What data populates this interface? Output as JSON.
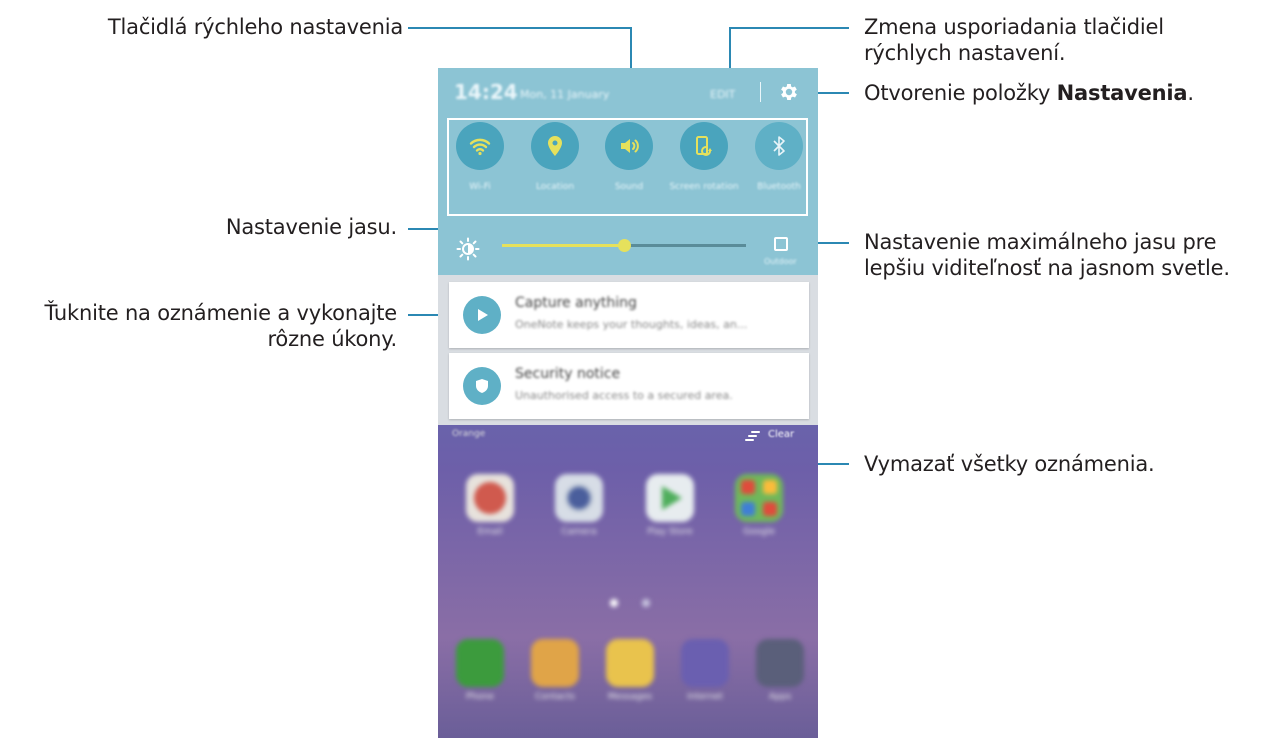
{
  "callouts": {
    "quick_buttons": "Tlačidlá rýchleho nastavenia",
    "rearrange_line1": "Zmena usporiadania tlačidiel",
    "rearrange_line2": "rýchlych nastavení.",
    "open_settings_prefix": "Otvorenie položky ",
    "open_settings_bold": "Nastavenia",
    "open_settings_suffix": ".",
    "brightness": "Nastavenie jasu.",
    "max_brightness_line1": "Nastavenie maximálneho jasu pre",
    "max_brightness_line2": "lepšiu viditeľnosť na jasnom svetle.",
    "notification_line1": "Ťuknite na oznámenie a vykonajte",
    "notification_line2": "rôzne úkony.",
    "clear_all": "Vymazať všetky oznámenia."
  },
  "phone": {
    "status": {
      "time": "14:24",
      "date": "Mon, 11 January",
      "edit": "EDIT"
    },
    "quick_settings": [
      {
        "label": "Wi-Fi",
        "icon": "wifi-icon"
      },
      {
        "label": "Location",
        "icon": "location-icon"
      },
      {
        "label": "Sound",
        "icon": "sound-icon"
      },
      {
        "label": "Screen rotation",
        "icon": "screen-rotation-icon"
      },
      {
        "label": "Bluetooth",
        "icon": "bluetooth-icon"
      }
    ],
    "brightness": {
      "level": 0.5,
      "outdoor_label": "Outdoor"
    },
    "notifications": [
      {
        "title": "Capture anything",
        "text": "OneNote keeps your thoughts, ideas, an..."
      },
      {
        "title": "Security notice",
        "text": "Unauthorised access to a secured area."
      }
    ],
    "clear": {
      "carrier": "Orange",
      "label": "Clear"
    },
    "apps": [
      {
        "label": "Email",
        "color": "#d05a4e"
      },
      {
        "label": "Camera",
        "color": "#b8c2d2"
      },
      {
        "label": "Play Store",
        "color": "#e7ecef"
      },
      {
        "label": "Google",
        "color": "#6fb85a"
      }
    ],
    "dock": [
      {
        "label": "Phone",
        "color": "#3c9b3d"
      },
      {
        "label": "Contacts",
        "color": "#e0a448"
      },
      {
        "label": "Messages",
        "color": "#e9c34d"
      },
      {
        "label": "Internet",
        "color": "#6a5fb0"
      },
      {
        "label": "Apps",
        "color": "#5a5f7a"
      }
    ],
    "colors": {
      "panel": "#8cc4d4",
      "accent_on": "#e6e15c",
      "leader_line": "#2b88b3"
    }
  }
}
